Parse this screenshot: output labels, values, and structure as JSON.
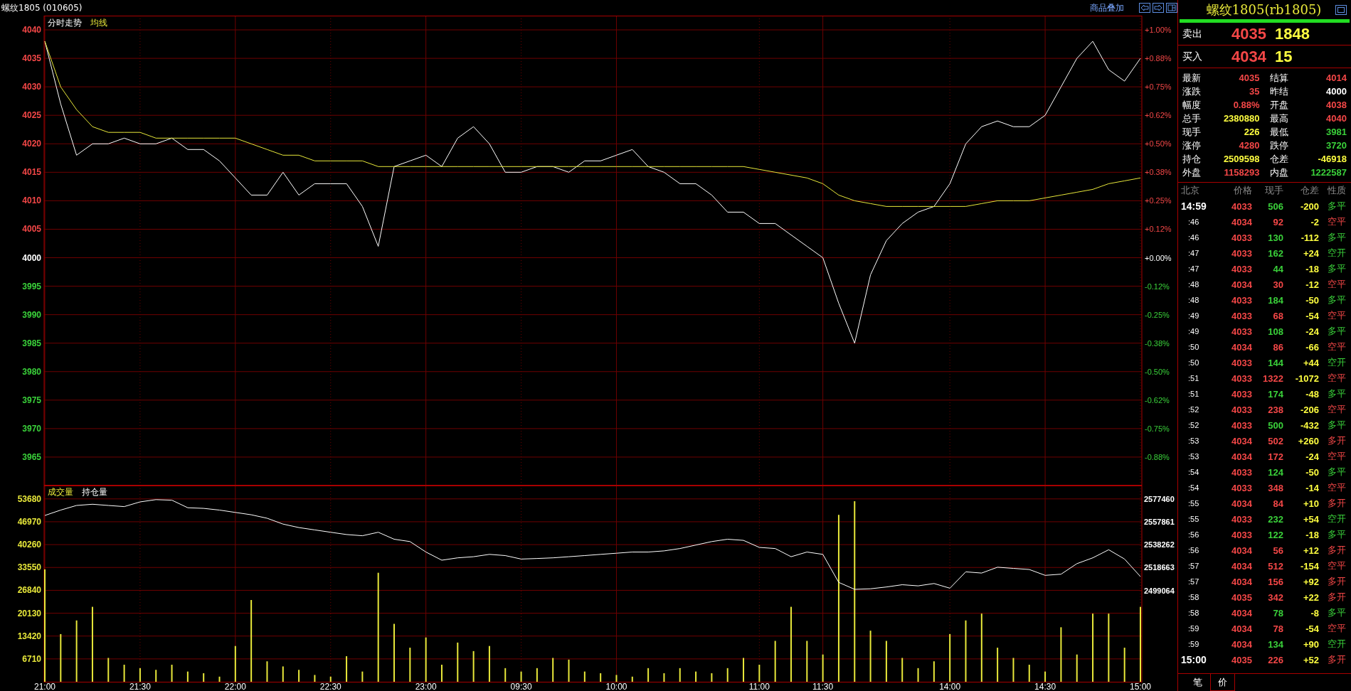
{
  "header": {
    "title": "螺纹1805 (010605)",
    "overlay_link": "商品叠加"
  },
  "price": {
    "right_ticks": [
      "+1.00%",
      "+0.88%",
      "+0.75%",
      "+0.62%",
      "+0.50%",
      "+0.38%",
      "+0.25%",
      "+0.12%",
      "+0.00%",
      "-0.12%",
      "-0.25%",
      "-0.38%",
      "-0.50%",
      "-0.62%",
      "-0.75%",
      "-0.88%"
    ],
    "chart_data": {
      "type": "line",
      "grid": true,
      "ylim": [
        3960,
        4042.5
      ],
      "categories": [
        null,
        null,
        null,
        null,
        null,
        null,
        null,
        null,
        null,
        null,
        null,
        null,
        null,
        null,
        null,
        null,
        null,
        null,
        null,
        null,
        null,
        null,
        null,
        null,
        null,
        null,
        null,
        null,
        null,
        null,
        null,
        null,
        null,
        null,
        null,
        null,
        null,
        null,
        null,
        null,
        null,
        null,
        null,
        null,
        null,
        null,
        null,
        null,
        null,
        null,
        null,
        null,
        null,
        null,
        null,
        null,
        null,
        null,
        null,
        null,
        null,
        null,
        null,
        null,
        null,
        null,
        null,
        null,
        null,
        null
      ],
      "yticks": [
        {
          "value": 4040,
          "label": "4040"
        },
        {
          "value": 4035,
          "label": "4035"
        },
        {
          "value": 4030,
          "label": "4030"
        },
        {
          "value": 4025,
          "label": "4025"
        },
        {
          "value": 4020,
          "label": "4020"
        },
        {
          "value": 4015,
          "label": "4015"
        },
        {
          "value": 4010,
          "label": "4010"
        },
        {
          "value": 4005,
          "label": "4005"
        },
        {
          "value": 4000,
          "label": "4000"
        },
        {
          "value": 3995,
          "label": "3995"
        },
        {
          "value": 3990,
          "label": "3990"
        },
        {
          "value": 3985,
          "label": "3985"
        },
        {
          "value": 3980,
          "label": "3980"
        },
        {
          "value": 3975,
          "label": "3975"
        },
        {
          "value": 3970,
          "label": "3970"
        },
        {
          "value": 3965,
          "label": "3965"
        }
      ],
      "series": [
        {
          "name": "分时走势",
          "color": "#ffffff",
          "values": [
            4038,
            4027,
            4018,
            4020,
            4020,
            4021,
            4020,
            4020,
            4021,
            4019,
            4019,
            4017,
            4014,
            4011,
            4011,
            4015,
            4011,
            4013,
            4013,
            4013,
            4009,
            4002,
            4016,
            4017,
            4018,
            4016,
            4021,
            4023,
            4020,
            4015,
            4015,
            4016,
            4016,
            4015,
            4017,
            4017,
            4018,
            4019,
            4016,
            4015,
            4013,
            4013,
            4011,
            4008,
            4008,
            4006,
            4006,
            4004,
            4002,
            4000,
            3992,
            3985,
            3997,
            4003,
            4006,
            4008,
            4009,
            4013,
            4020,
            4023,
            4024,
            4023,
            4023,
            4025,
            4030,
            4035,
            4038,
            4033,
            4031,
            4035
          ]
        },
        {
          "name": "均线",
          "color": "#e8e83a",
          "values": [
            4038,
            4030,
            4026,
            4023,
            4022,
            4022,
            4022,
            4021,
            4021,
            4021,
            4021,
            4021,
            4021,
            4020,
            4019,
            4018,
            4018,
            4017,
            4017,
            4017,
            4017,
            4016,
            4016,
            4016,
            4016,
            4016,
            4016,
            4016,
            4016,
            4016,
            4016,
            4016,
            4016,
            4016,
            4016,
            4016,
            4016,
            4016,
            4016,
            4016,
            4016,
            4016,
            4016,
            4016,
            4016,
            4015.5,
            4015,
            4014.5,
            4014,
            4013,
            4011,
            4010,
            4009.5,
            4009,
            4009,
            4009,
            4009,
            4009,
            4009,
            4009.5,
            4010,
            4010,
            4010,
            4010.5,
            4011,
            4011.5,
            4012,
            4013,
            4013.5,
            4014
          ]
        }
      ]
    }
  },
  "volume": {
    "chart_data": {
      "type": "bar",
      "grid": true,
      "ylim": [
        0,
        57600
      ],
      "categories": [
        "21:00",
        null,
        null,
        null,
        null,
        null,
        "21:30",
        null,
        null,
        null,
        null,
        null,
        "22:00",
        null,
        null,
        null,
        null,
        null,
        "22:30",
        null,
        null,
        null,
        null,
        null,
        "23:00",
        null,
        null,
        null,
        null,
        null,
        "09:30",
        null,
        null,
        null,
        null,
        null,
        "10:00",
        null,
        null,
        null,
        null,
        null,
        null,
        null,
        null,
        "11:00",
        null,
        null,
        null,
        "11:30",
        null,
        null,
        null,
        null,
        null,
        null,
        null,
        "14:00",
        null,
        null,
        null,
        null,
        null,
        "14:30",
        null,
        null,
        null,
        null,
        null,
        "15:00"
      ],
      "yticks": [
        {
          "value": 53680,
          "label": "53680"
        },
        {
          "value": 46970,
          "label": "46970"
        },
        {
          "value": 40260,
          "label": "40260"
        },
        {
          "value": 33550,
          "label": "33550"
        },
        {
          "value": 26840,
          "label": "26840"
        },
        {
          "value": 20130,
          "label": "20130"
        },
        {
          "value": 13420,
          "label": "13420"
        },
        {
          "value": 6710,
          "label": "6710"
        }
      ],
      "series": [
        {
          "name": "成交量",
          "color": "#e8e83a",
          "values": [
            33000,
            14000,
            18000,
            22000,
            7000,
            5000,
            4000,
            3500,
            5000,
            3000,
            2500,
            1500,
            10500,
            24000,
            6000,
            4500,
            3500,
            2000,
            1500,
            7500,
            3000,
            32000,
            17000,
            10000,
            13000,
            5000,
            11500,
            9000,
            10500,
            4000,
            3000,
            4000,
            7000,
            6500,
            3000,
            2500,
            2000,
            1500,
            4000,
            2500,
            4000,
            3000,
            2500,
            4000,
            7000,
            5000,
            12000,
            22000,
            12000,
            8000,
            49000,
            53000,
            15000,
            12000,
            7000,
            4000,
            6000,
            14000,
            18000,
            20000,
            10000,
            7000,
            5000,
            3000,
            16000,
            8000,
            20000,
            20000,
            10000,
            22000
          ]
        }
      ]
    }
  },
  "open_interest": {
    "chart_data": {
      "type": "line",
      "ylim": [
        2420740,
        2589046
      ],
      "categories": [
        null,
        null,
        null,
        null,
        null,
        null,
        null,
        null,
        null,
        null,
        null,
        null,
        null,
        null,
        null,
        null,
        null,
        null,
        null,
        null,
        null,
        null,
        null,
        null,
        null,
        null,
        null,
        null,
        null,
        null,
        null,
        null,
        null,
        null,
        null,
        null,
        null,
        null,
        null,
        null,
        null,
        null,
        null,
        null,
        null,
        null,
        null,
        null,
        null,
        null,
        null,
        null,
        null,
        null,
        null,
        null,
        null,
        null,
        null,
        null,
        null,
        null,
        null,
        null,
        null,
        null,
        null,
        null,
        null,
        null
      ],
      "yticks": [
        {
          "value": 2577460,
          "label": "2577460"
        },
        {
          "value": 2557861,
          "label": "2557861"
        },
        {
          "value": 2538262,
          "label": "2538262"
        },
        {
          "value": 2518663,
          "label": "2518663"
        },
        {
          "value": 2499064,
          "label": "2499064"
        }
      ],
      "series": [
        {
          "name": "持仓量",
          "color": "#ffffff",
          "values": [
            2563400,
            2568000,
            2572000,
            2573000,
            2572000,
            2571000,
            2575000,
            2577000,
            2576500,
            2570000,
            2569500,
            2568000,
            2566000,
            2564000,
            2561000,
            2556000,
            2553000,
            2551000,
            2549000,
            2547000,
            2546000,
            2549000,
            2543000,
            2541000,
            2532000,
            2525000,
            2527000,
            2528000,
            2530000,
            2529000,
            2526000,
            2526500,
            2527000,
            2528000,
            2529000,
            2530000,
            2531000,
            2532000,
            2532000,
            2533000,
            2535000,
            2538000,
            2541000,
            2543000,
            2542000,
            2536000,
            2535000,
            2528000,
            2532000,
            2530000,
            2506000,
            2500000,
            2500500,
            2502000,
            2504000,
            2503000,
            2505000,
            2501000,
            2515000,
            2514000,
            2519000,
            2518000,
            2517000,
            2512000,
            2513000,
            2522000,
            2527000,
            2534000,
            2526000,
            2511000
          ]
        }
      ]
    }
  },
  "side_title": "螺纹1805(rb1805)",
  "ask": {
    "label": "卖出",
    "price": "4035",
    "volume": "1848"
  },
  "bid": {
    "label": "买入",
    "price": "4034",
    "volume": "15"
  },
  "quotes": [
    {
      "label": "最新",
      "value": "4035",
      "color": "#f44747"
    },
    {
      "label": "结算",
      "value": "4014",
      "color": "#f44747"
    },
    {
      "label": "涨跌",
      "value": "35",
      "color": "#f44747"
    },
    {
      "label": "昨结",
      "value": "4000",
      "color": "#ffffff"
    },
    {
      "label": "幅度",
      "value": "0.88%",
      "color": "#f44747"
    },
    {
      "label": "开盘",
      "value": "4038",
      "color": "#f44747"
    },
    {
      "label": "总手",
      "value": "2380880",
      "color": "#ffff40"
    },
    {
      "label": "最高",
      "value": "4040",
      "color": "#f44747"
    },
    {
      "label": "现手",
      "value": "226",
      "color": "#ffff40"
    },
    {
      "label": "最低",
      "value": "3981",
      "color": "#3ad13a"
    },
    {
      "label": "涨停",
      "value": "4280",
      "color": "#f44747"
    },
    {
      "label": "跌停",
      "value": "3720",
      "color": "#3ad13a"
    },
    {
      "label": "持仓",
      "value": "2509598",
      "color": "#ffff40"
    },
    {
      "label": "仓差",
      "value": "-46918",
      "color": "#ffff40"
    },
    {
      "label": "外盘",
      "value": "1158293",
      "color": "#f44747"
    },
    {
      "label": "内盘",
      "value": "1222587",
      "color": "#3ad13a"
    }
  ],
  "trades": {
    "columns": [
      "北京",
      "价格",
      "现手",
      "仓差",
      "性质"
    ],
    "rows": [
      {
        "kind": "full",
        "time": "14:59",
        "price": "4033",
        "hand": "506",
        "diff": "-200",
        "type": "多平",
        "color": "#3ad13a"
      },
      {
        "kind": "short",
        "time": ":46",
        "price": "4034",
        "hand": "92",
        "diff": "-2",
        "type": "空平",
        "color": "#f44747"
      },
      {
        "kind": "short",
        "time": ":46",
        "price": "4033",
        "hand": "130",
        "diff": "-112",
        "type": "多平",
        "color": "#3ad13a"
      },
      {
        "kind": "short",
        "time": ":47",
        "price": "4033",
        "hand": "162",
        "diff": "+24",
        "type": "空开",
        "color": "#3ad13a"
      },
      {
        "kind": "short",
        "time": ":47",
        "price": "4033",
        "hand": "44",
        "diff": "-18",
        "type": "多平",
        "color": "#3ad13a"
      },
      {
        "kind": "short",
        "time": ":48",
        "price": "4034",
        "hand": "30",
        "diff": "-12",
        "type": "空平",
        "color": "#f44747"
      },
      {
        "kind": "short",
        "time": ":48",
        "price": "4033",
        "hand": "184",
        "diff": "-50",
        "type": "多平",
        "color": "#3ad13a"
      },
      {
        "kind": "short",
        "time": ":49",
        "price": "4033",
        "hand": "68",
        "diff": "-54",
        "type": "空平",
        "color": "#f44747"
      },
      {
        "kind": "short",
        "time": ":49",
        "price": "4033",
        "hand": "108",
        "diff": "-24",
        "type": "多平",
        "color": "#3ad13a"
      },
      {
        "kind": "short",
        "time": ":50",
        "price": "4034",
        "hand": "86",
        "diff": "-66",
        "type": "空平",
        "color": "#f44747"
      },
      {
        "kind": "short",
        "time": ":50",
        "price": "4033",
        "hand": "144",
        "diff": "+44",
        "type": "空开",
        "color": "#3ad13a"
      },
      {
        "kind": "short",
        "time": ":51",
        "price": "4033",
        "hand": "1322",
        "diff": "-1072",
        "type": "空平",
        "color": "#f44747"
      },
      {
        "kind": "short",
        "time": ":51",
        "price": "4033",
        "hand": "174",
        "diff": "-48",
        "type": "多平",
        "color": "#3ad13a"
      },
      {
        "kind": "short",
        "time": ":52",
        "price": "4033",
        "hand": "238",
        "diff": "-206",
        "type": "空平",
        "color": "#f44747"
      },
      {
        "kind": "short",
        "time": ":52",
        "price": "4033",
        "hand": "500",
        "diff": "-432",
        "type": "多平",
        "color": "#3ad13a"
      },
      {
        "kind": "short",
        "time": ":53",
        "price": "4034",
        "hand": "502",
        "diff": "+260",
        "type": "多开",
        "color": "#f44747"
      },
      {
        "kind": "short",
        "time": ":53",
        "price": "4034",
        "hand": "172",
        "diff": "-24",
        "type": "空平",
        "color": "#f44747"
      },
      {
        "kind": "short",
        "time": ":54",
        "price": "4033",
        "hand": "124",
        "diff": "-50",
        "type": "多平",
        "color": "#3ad13a"
      },
      {
        "kind": "short",
        "time": ":54",
        "price": "4033",
        "hand": "348",
        "diff": "-14",
        "type": "空平",
        "color": "#f44747"
      },
      {
        "kind": "short",
        "time": ":55",
        "price": "4034",
        "hand": "84",
        "diff": "+10",
        "type": "多开",
        "color": "#f44747"
      },
      {
        "kind": "short",
        "time": ":55",
        "price": "4033",
        "hand": "232",
        "diff": "+54",
        "type": "空开",
        "color": "#3ad13a"
      },
      {
        "kind": "short",
        "time": ":56",
        "price": "4033",
        "hand": "122",
        "diff": "-18",
        "type": "多平",
        "color": "#3ad13a"
      },
      {
        "kind": "short",
        "time": ":56",
        "price": "4034",
        "hand": "56",
        "diff": "+12",
        "type": "多开",
        "color": "#f44747"
      },
      {
        "kind": "short",
        "time": ":57",
        "price": "4034",
        "hand": "512",
        "diff": "-154",
        "type": "空平",
        "color": "#f44747"
      },
      {
        "kind": "short",
        "time": ":57",
        "price": "4034",
        "hand": "156",
        "diff": "+92",
        "type": "多开",
        "color": "#f44747"
      },
      {
        "kind": "short",
        "time": ":58",
        "price": "4035",
        "hand": "342",
        "diff": "+22",
        "type": "多开",
        "color": "#f44747"
      },
      {
        "kind": "short",
        "time": ":58",
        "price": "4034",
        "hand": "78",
        "diff": "-8",
        "type": "多平",
        "color": "#3ad13a"
      },
      {
        "kind": "short",
        "time": ":59",
        "price": "4034",
        "hand": "78",
        "diff": "-54",
        "type": "空平",
        "color": "#f44747"
      },
      {
        "kind": "short",
        "time": ":59",
        "price": "4034",
        "hand": "134",
        "diff": "+90",
        "type": "空开",
        "color": "#3ad13a"
      },
      {
        "kind": "full",
        "time": "15:00",
        "price": "4035",
        "hand": "226",
        "diff": "+52",
        "type": "多开",
        "color": "#f44747"
      }
    ]
  },
  "tabs": [
    {
      "label": "笔",
      "selected": true
    },
    {
      "label": "价",
      "selected": false
    }
  ]
}
